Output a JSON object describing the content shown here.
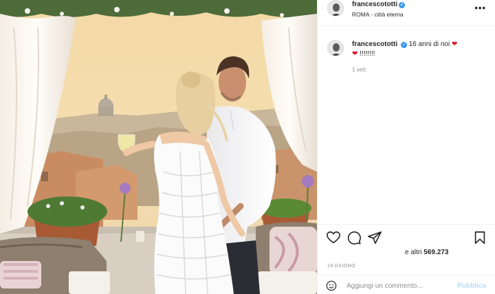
{
  "post": {
    "username": "francescototti",
    "location": "ROMA - città eterna",
    "more_label": "•••",
    "caption": {
      "username": "francescototti",
      "text": "16 anni di noi",
      "heart": "❤",
      "heart2": "❤",
      "exclaim": "!!!!!!!!",
      "time": "1 sett."
    },
    "likes_prefix": "e altri",
    "likes_count": "569.273",
    "date": "19 GIUGNO",
    "comment_placeholder": "Aggiungi un commento...",
    "post_label": "Pubblica"
  },
  "colors": {
    "link_blue": "#3897f0",
    "post_disabled": "#b2dffc",
    "heart_red": "#e0132b"
  },
  "icons": [
    "more-options-icon",
    "verified-icon",
    "like-heart-icon",
    "comment-icon",
    "share-icon",
    "save-bookmark-icon",
    "emoji-icon"
  ]
}
